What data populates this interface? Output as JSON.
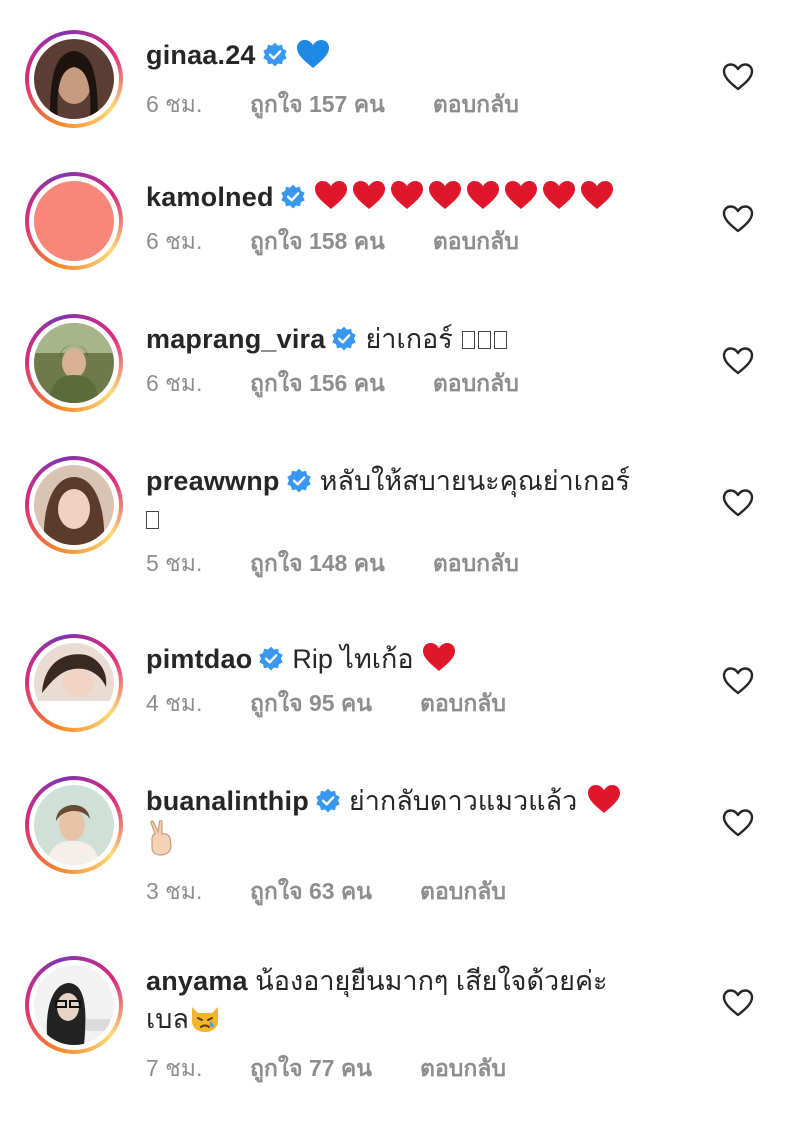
{
  "comments": [
    {
      "username": "ginaa.24",
      "text": "",
      "time": "6 ชม.",
      "likes": "ถูกใจ 157 คน",
      "reply": "ตอบกลับ"
    },
    {
      "username": "kamolned",
      "text": "",
      "time": "6 ชม.",
      "likes": "ถูกใจ 158 คน",
      "reply": "ตอบกลับ"
    },
    {
      "username": "maprang_vira",
      "text": "ย่าเกอร์",
      "time": "6 ชม.",
      "likes": "ถูกใจ 156 คน",
      "reply": "ตอบกลับ"
    },
    {
      "username": "preawwnp",
      "text": "หลับให้สบายนะคุณย่าเกอร์",
      "time": "5 ชม.",
      "likes": "ถูกใจ 148 คน",
      "reply": "ตอบกลับ"
    },
    {
      "username": "pimtdao",
      "text": "Rip ไทเก้อ",
      "time": "4 ชม.",
      "likes": "ถูกใจ 95 คน",
      "reply": "ตอบกลับ"
    },
    {
      "username": "buanalinthip",
      "text": "ย่ากลับดาวแมวแล้ว",
      "time": "3 ชม.",
      "likes": "ถูกใจ 63 คน",
      "reply": "ตอบกลับ"
    },
    {
      "username": "anyama",
      "text": "น้องอายุยืนมากๆ เสียใจด้วยค่ะ",
      "text2": "เบล",
      "time": "7 ชม.",
      "likes": "ถูกใจ 77 คน",
      "reply": "ตอบกลับ"
    }
  ],
  "colors": {
    "verified": "#3897f0",
    "meta": "#8e8e8e",
    "text": "#262626",
    "heart": "#e0162b"
  },
  "icons": {
    "verified": "verified-badge-icon",
    "like": "heart-outline-icon"
  }
}
